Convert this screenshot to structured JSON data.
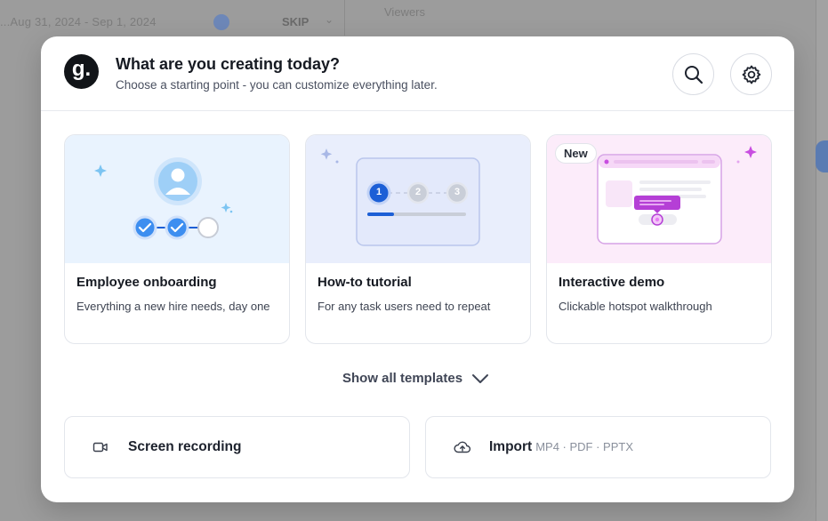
{
  "background": {
    "date_range": "...Aug 31, 2024 - Sep 1, 2024",
    "filter_value": "SKIP",
    "column_label": "Viewers"
  },
  "modal": {
    "logo_letter": "g.",
    "title": "What are you creating today?",
    "subtitle": "Choose a starting point - you can customize everything later.",
    "header_icons": [
      "search-icon",
      "gear-icon"
    ]
  },
  "templates": [
    {
      "name": "Employee onboarding",
      "description": "Everything a new hire needs, day one"
    },
    {
      "name": "How-to tutorial",
      "description": "For any task users need to repeat",
      "steps": [
        "1",
        "2",
        "3"
      ]
    },
    {
      "name": "Interactive demo",
      "description": "Clickable hotspot walkthrough",
      "badge": "New"
    }
  ],
  "show_all_label": "Show all templates",
  "actions": {
    "screen_recording": {
      "label": "Screen recording",
      "icon": "video-camera-icon"
    },
    "import": {
      "label": "Import",
      "hint": "MP4 · PDF · PPTX",
      "icon": "cloud-upload-icon"
    }
  },
  "colors": {
    "accent_blue": "#1c5fd6",
    "check_blue": "#3d8ef0",
    "demo_purple": "#b53fd6",
    "logo_bg": "#111418"
  }
}
